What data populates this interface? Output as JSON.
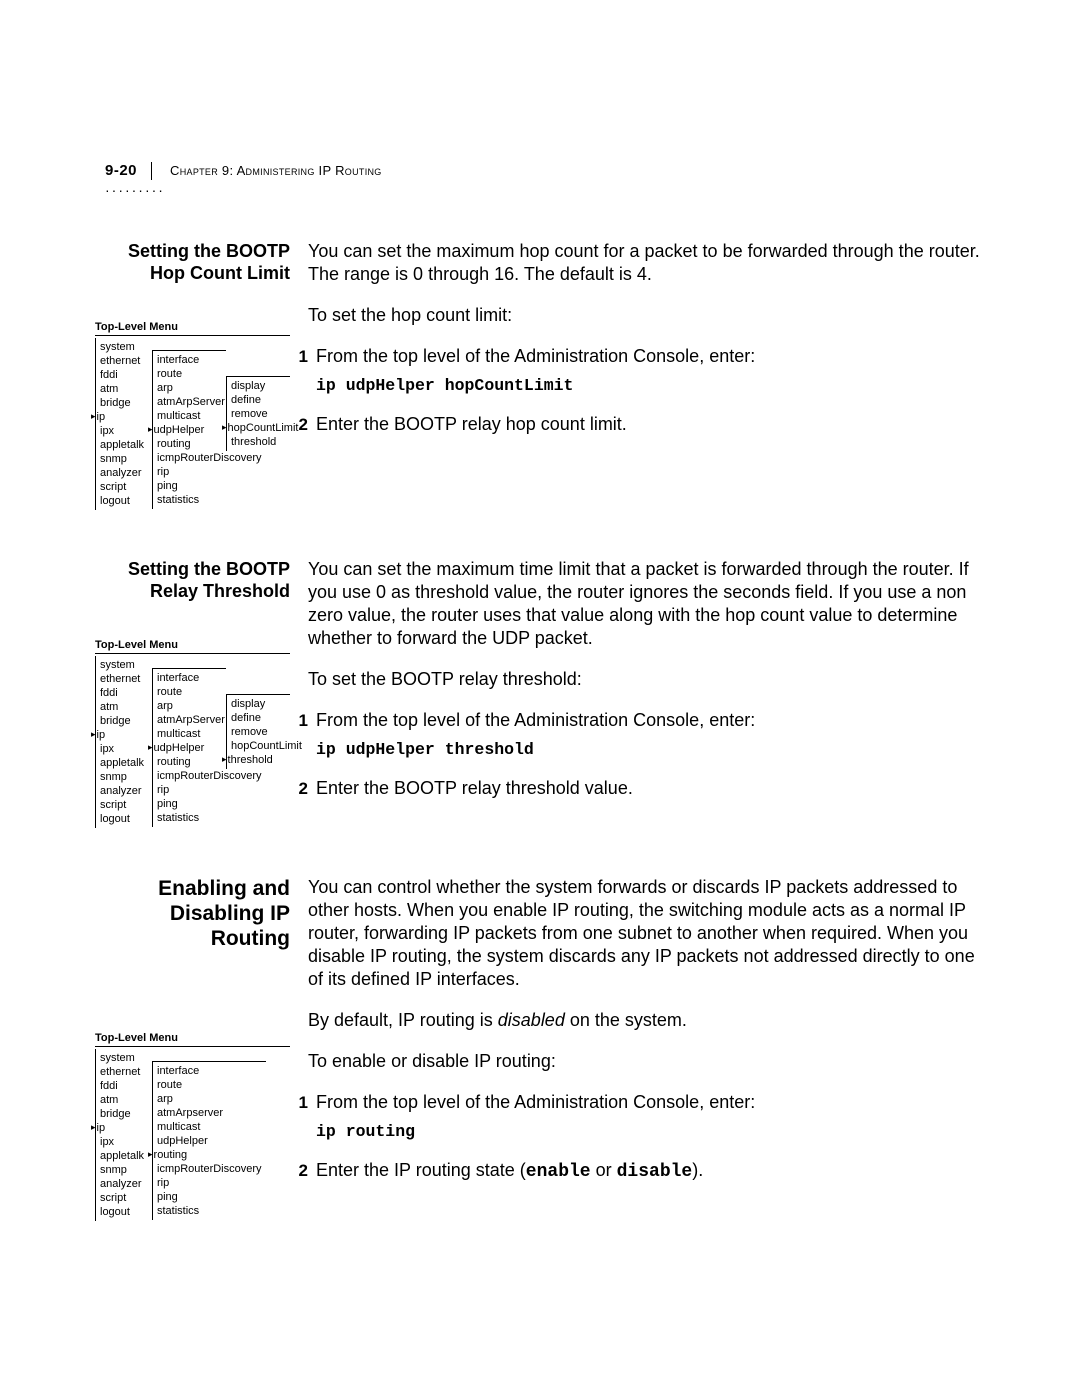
{
  "header": {
    "page_number": "9-20",
    "chapter": "Chapter 9: Administering IP Routing",
    "dots": "·········"
  },
  "menu_title": "Top-Level Menu",
  "section1": {
    "heading_l1": "Setting the BOOTP",
    "heading_l2": "Hop Count Limit",
    "intro": "You can set the maximum hop count for a packet to be forwarded through the router. The range is 0 through 16. The default is 4.",
    "toset": "To set the hop count limit:",
    "step1": "From the top level of the Administration Console, enter:",
    "cmd": "ip udpHelper hopCountLimit",
    "step2": "Enter the BOOTP relay hop count limit.",
    "menu": {
      "c1": [
        "system",
        "ethernet",
        "fddi",
        "atm",
        "bridge",
        "ip",
        "ipx",
        "appletalk",
        "snmp",
        "analyzer",
        "script",
        "logout"
      ],
      "c1_arrow_index": 5,
      "c2": [
        "interface",
        "route",
        "arp",
        "atmArpServer",
        "multicast",
        "udpHelper",
        "routing",
        "icmpRouterDiscovery",
        "rip",
        "ping",
        "statistics"
      ],
      "c2_arrow_index": 5,
      "c3": [
        "display",
        "define",
        "remove",
        "hopCountLimit",
        "threshold"
      ],
      "c3_arrow_index": 3
    }
  },
  "section2": {
    "heading_l1": "Setting the BOOTP",
    "heading_l2": "Relay Threshold",
    "intro": "You can set the maximum time limit that a packet is forwarded through the router. If you use 0 as threshold value, the router ignores the seconds field. If you use a non zero value, the router uses that value along with the hop count value to determine whether to forward the UDP packet.",
    "toset": "To set the BOOTP relay threshold:",
    "step1": "From the top level of the Administration Console, enter:",
    "cmd": "ip udpHelper threshold",
    "step2": "Enter the BOOTP relay threshold value.",
    "menu": {
      "c1": [
        "system",
        "ethernet",
        "fddi",
        "atm",
        "bridge",
        "ip",
        "ipx",
        "appletalk",
        "snmp",
        "analyzer",
        "script",
        "logout"
      ],
      "c1_arrow_index": 5,
      "c2": [
        "interface",
        "route",
        "arp",
        "atmArpServer",
        "multicast",
        "udpHelper",
        "routing",
        "icmpRouterDiscovery",
        "rip",
        "ping",
        "statistics"
      ],
      "c2_arrow_index": 5,
      "c3": [
        "display",
        "define",
        "remove",
        "hopCountLimit",
        "threshold"
      ],
      "c3_arrow_index": 4
    }
  },
  "section3": {
    "heading_l1": "Enabling and",
    "heading_l2": "Disabling IP",
    "heading_l3": "Routing",
    "intro": "You can control whether the system forwards or discards IP packets addressed to other hosts. When you enable IP routing, the switching module acts as a normal IP router, forwarding IP packets from one subnet to another when required. When you disable IP routing, the system discards any IP packets not addressed directly to one of its defined IP interfaces.",
    "default_pre": "By default, IP routing is ",
    "default_em": "disabled",
    "default_post": " on the system.",
    "toset": "To enable or disable IP routing:",
    "step1": "From the top level of the Administration Console, enter:",
    "cmd": "ip routing",
    "step2_pre": "Enter the IP routing state (",
    "step2_opt1": "enable",
    "step2_mid": " or ",
    "step2_opt2": "disable",
    "step2_post": ").",
    "menu": {
      "c1": [
        "system",
        "ethernet",
        "fddi",
        "atm",
        "bridge",
        "ip",
        "ipx",
        "appletalk",
        "snmp",
        "analyzer",
        "script",
        "logout"
      ],
      "c1_arrow_index": 5,
      "c2": [
        "interface",
        "route",
        "arp",
        "atmArpserver",
        "multicast",
        "udpHelper",
        "routing",
        "icmpRouterDiscovery",
        "rip",
        "ping",
        "statistics"
      ],
      "c2_arrow_index": 6
    }
  },
  "labels": {
    "num1": "1",
    "num2": "2"
  }
}
